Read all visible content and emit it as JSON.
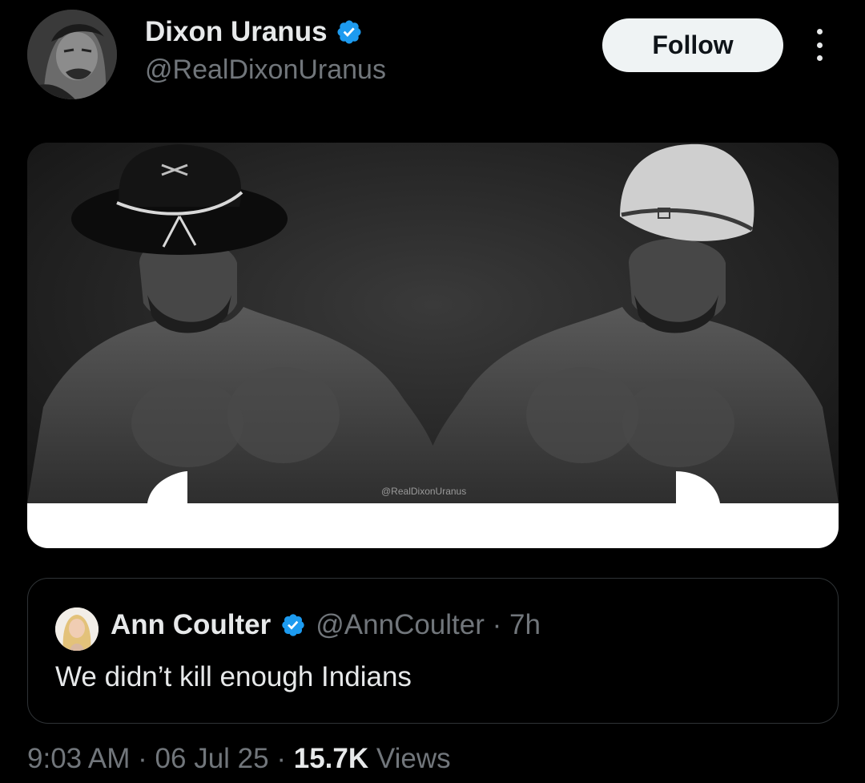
{
  "tweet": {
    "author": {
      "display_name": "Dixon Uranus",
      "handle": "@RealDixonUranus",
      "verified": true
    },
    "follow_label": "Follow",
    "more_icon": "more-vertical-icon",
    "media": {
      "watermark": "@RealDixonUranus"
    },
    "quoted": {
      "display_name": "Ann Coulter",
      "handle": "@AnnCoulter",
      "separator": "·",
      "time": "7h",
      "text": "We didn’t kill enough Indians"
    },
    "meta": {
      "time": "9:03 AM",
      "dot1": "·",
      "date": "06 Jul 25",
      "dot2": "·",
      "views_count": "15.7K",
      "views_label": "Views"
    }
  },
  "colors": {
    "background": "#000000",
    "text_primary": "#e7e9ea",
    "text_secondary": "#71767b",
    "verified_blue": "#1d9bf0",
    "border": "#2f3336",
    "follow_bg": "#eff3f4"
  }
}
